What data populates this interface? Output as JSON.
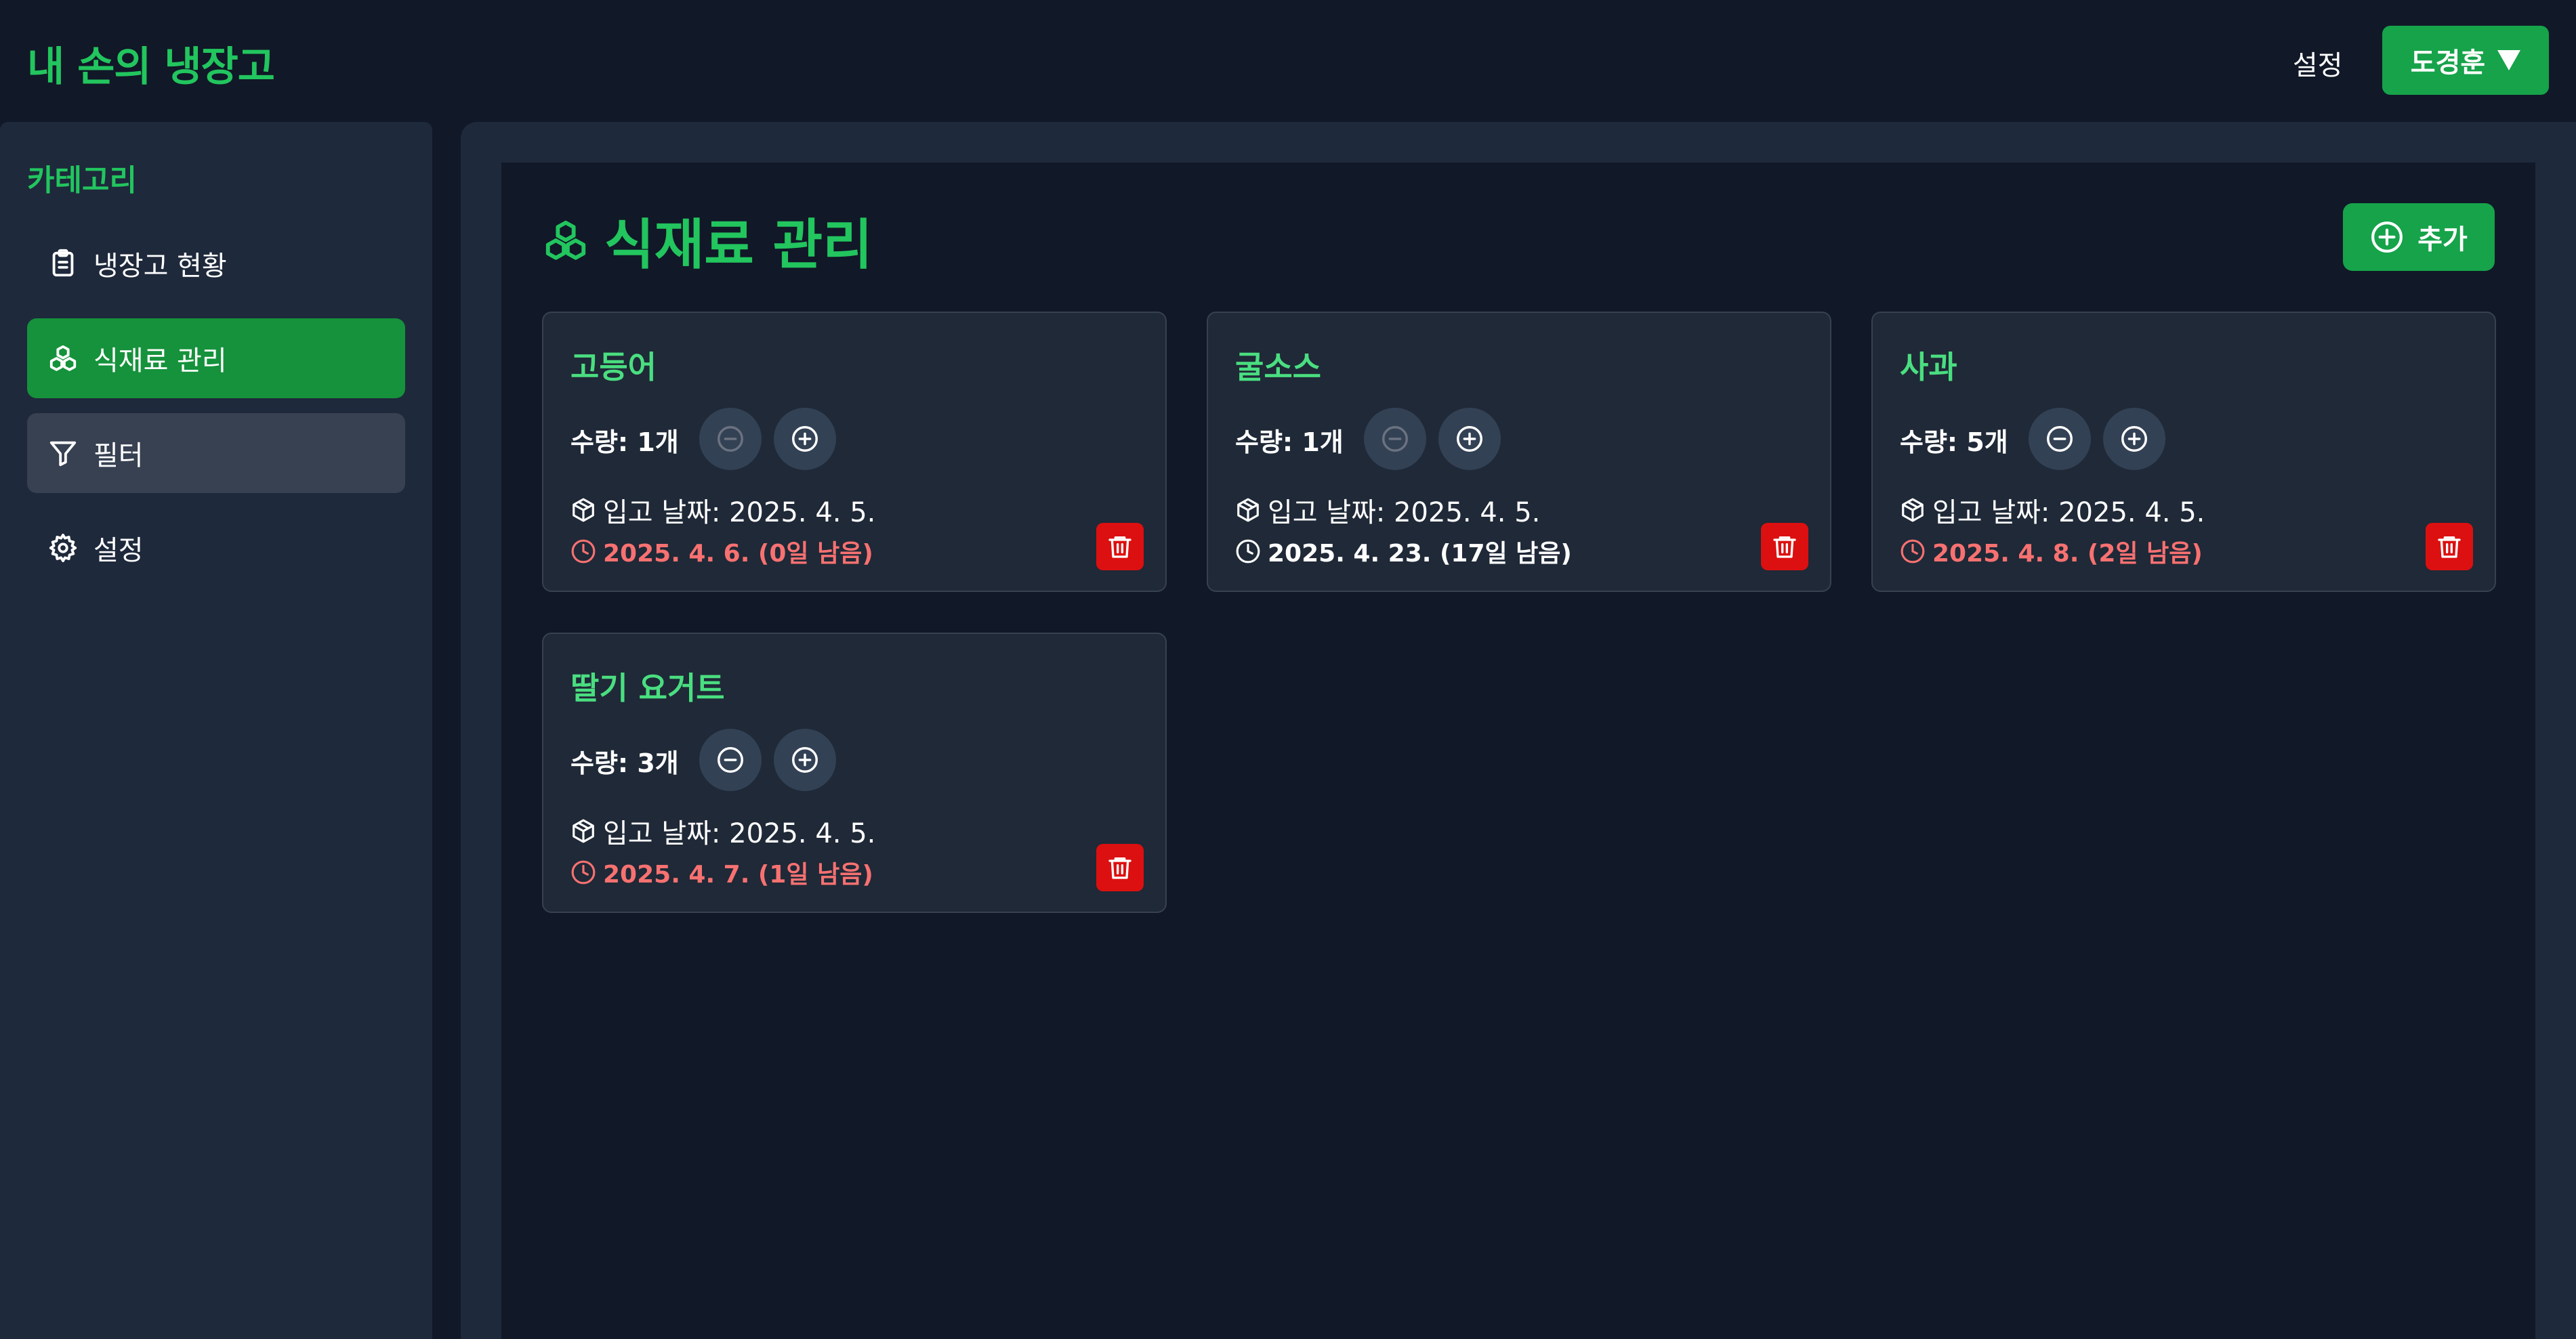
{
  "header": {
    "app_title": "내 손의 냉장고",
    "settings_label": "설정",
    "user_name": "도경훈"
  },
  "sidebar": {
    "heading": "카테고리",
    "items": [
      {
        "label": "냉장고 현황",
        "icon": "clipboard-icon"
      },
      {
        "label": "식재료 관리",
        "icon": "ingredients-icon",
        "active": true
      },
      {
        "label": "필터",
        "icon": "filter-icon"
      },
      {
        "label": "설정",
        "icon": "gear-icon"
      }
    ]
  },
  "main": {
    "title": "식재료 관리",
    "add_label": "추가"
  },
  "colors": {
    "accent": "#22c55e",
    "warning": "#f87171",
    "delete": "#dc1010"
  },
  "ingredients": [
    {
      "name": "고등어",
      "quantity": "수량: 1개",
      "stock_date": "입고 날짜: 2025. 4. 5.",
      "expiry": "2025. 4. 6. (0일 남음)",
      "urgent": true
    },
    {
      "name": "굴소스",
      "quantity": "수량: 1개",
      "stock_date": "입고 날짜: 2025. 4. 5.",
      "expiry": "2025. 4. 23. (17일 남음)",
      "urgent": false
    },
    {
      "name": "사과",
      "quantity": "수량: 5개",
      "stock_date": "입고 날짜: 2025. 4. 5.",
      "expiry": "2025. 4. 8. (2일 남음)",
      "urgent": true
    },
    {
      "name": "딸기 요거트",
      "quantity": "수량: 3개",
      "stock_date": "입고 날짜: 2025. 4. 5.",
      "expiry": "2025. 4. 7. (1일 남음)",
      "urgent": true
    }
  ]
}
